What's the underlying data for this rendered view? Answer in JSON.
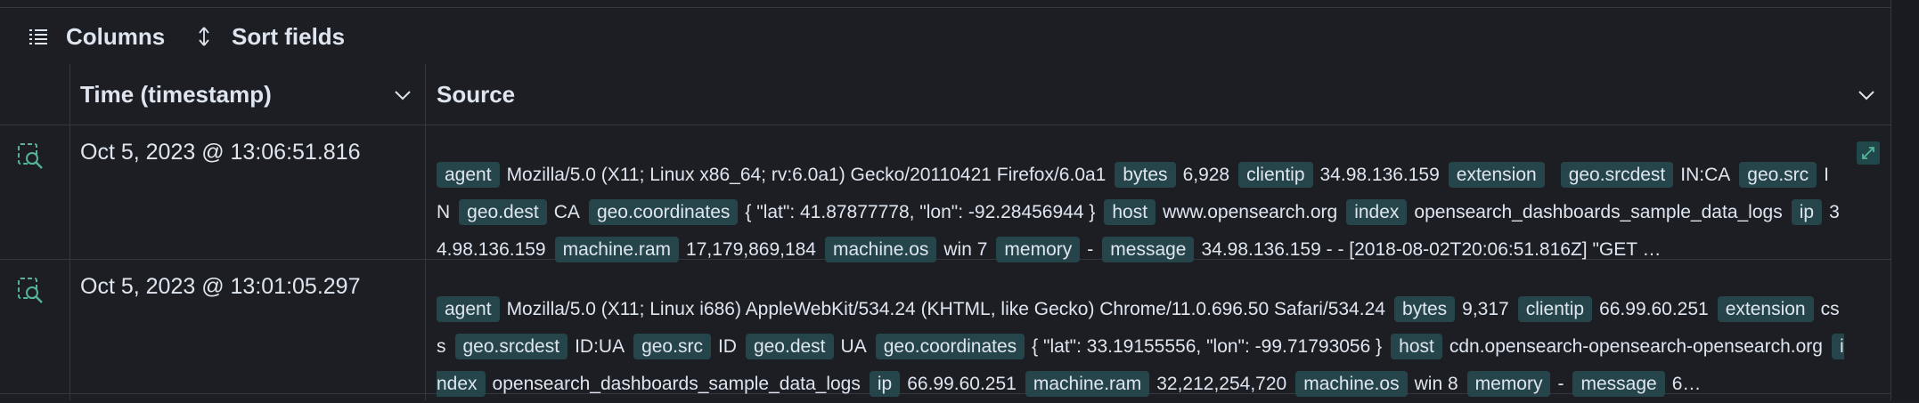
{
  "toolbar": {
    "columns_label": "Columns",
    "sort_label": "Sort fields",
    "columns_icon": "list-icon",
    "sort_icon": "sort-arrows-icon"
  },
  "table": {
    "headers": {
      "time": "Time (timestamp)",
      "source": "Source"
    },
    "rows": [
      {
        "timestamp": "Oct 5, 2023 @ 13:06:51.816",
        "fields": [
          [
            "agent",
            "Mozilla/5.0 (X11; Linux x86_64; rv:6.0a1) Gecko/20110421 Firefox/6.0a1"
          ],
          [
            "bytes",
            "6,928"
          ],
          [
            "clientip",
            "34.98.136.159"
          ],
          [
            "extension",
            ""
          ],
          [
            "geo.srcdest",
            "IN:CA"
          ],
          [
            "geo.src",
            "IN"
          ],
          [
            "geo.dest",
            "CA"
          ],
          [
            "geo.coordinates",
            "{ \"lat\": 41.87877778, \"lon\": -92.28456944 }"
          ],
          [
            "host",
            "www.opensearch.org"
          ],
          [
            "index",
            "opensearch_dashboards_sample_data_logs"
          ],
          [
            "ip",
            "34.98.136.159"
          ],
          [
            "machine.ram",
            "17,179,869,184"
          ],
          [
            "machine.os",
            "win 7"
          ],
          [
            "memory",
            "-"
          ],
          [
            "message",
            "34.98.136.159 - - [2018-08-02T20:06:51.816Z] \"GET …"
          ]
        ]
      },
      {
        "timestamp": "Oct 5, 2023 @ 13:01:05.297",
        "fields": [
          [
            "agent",
            "Mozilla/5.0 (X11; Linux i686) AppleWebKit/534.24 (KHTML, like Gecko) Chrome/11.0.696.50 Safari/534.24"
          ],
          [
            "bytes",
            "9,317"
          ],
          [
            "clientip",
            "66.99.60.251"
          ],
          [
            "extension",
            "css"
          ],
          [
            "geo.srcdest",
            "ID:UA"
          ],
          [
            "geo.src",
            "ID"
          ],
          [
            "geo.dest",
            "UA"
          ],
          [
            "geo.coordinates",
            "{ \"lat\": 33.19155556, \"lon\": -99.71793056 }"
          ],
          [
            "host",
            "cdn.opensearch-opensearch-opensearch.org"
          ],
          [
            "index",
            "opensearch_dashboards_sample_data_logs"
          ],
          [
            "ip",
            "66.99.60.251"
          ],
          [
            "machine.ram",
            "32,212,254,720"
          ],
          [
            "machine.os",
            "win 8"
          ],
          [
            "memory",
            "-"
          ],
          [
            "message",
            "6…"
          ]
        ]
      }
    ]
  },
  "colors": {
    "background": "#1d1e24",
    "field_badge": "#25454a",
    "accent": "#54b399",
    "border": "#343741"
  }
}
